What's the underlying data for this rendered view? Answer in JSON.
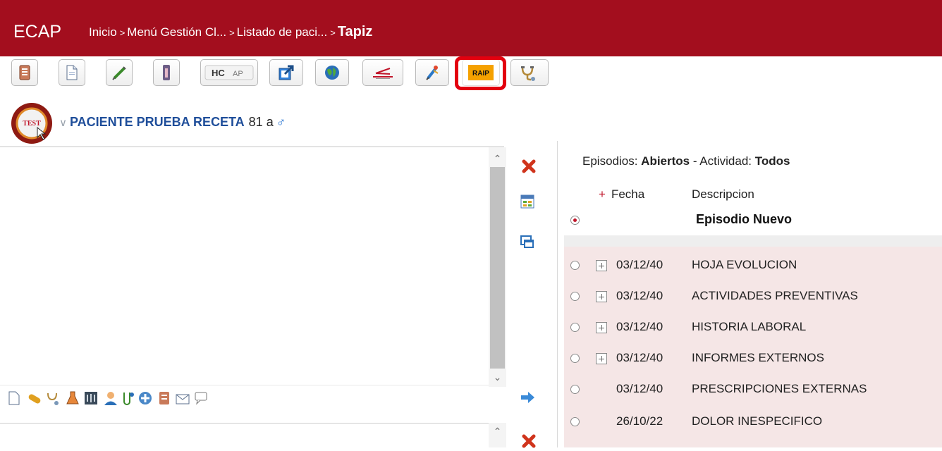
{
  "app": {
    "title": "ECAP"
  },
  "breadcrumb": {
    "items": [
      "Inicio",
      "Menú Gestión Cl...",
      "Listado de paci..."
    ],
    "current": "Tapiz",
    "separator": ">"
  },
  "toolbar": {
    "buttons": [
      {
        "name": "clinical-report-icon"
      },
      {
        "name": "document-icon"
      },
      {
        "name": "syringe-icon"
      },
      {
        "name": "thermometer-icon"
      },
      {
        "name": "hc-ap-button",
        "label": "HC AP"
      },
      {
        "name": "external-link-icon"
      },
      {
        "name": "globe-icon"
      },
      {
        "name": "chart-logo-icon"
      },
      {
        "name": "vaccine-icon"
      },
      {
        "name": "raip-button",
        "label": "RAIP"
      },
      {
        "name": "stethoscope-icon"
      }
    ],
    "highlighted": "raip-button",
    "highlight_color": "#e3000f"
  },
  "patient": {
    "avatar_text": "TEST",
    "name": "PACIENTE PRUEBA RECETA",
    "age": "81 a",
    "sex_symbol": "♂"
  },
  "episodes": {
    "filter_prefix": "Episodios: ",
    "filter_open": "Abiertos",
    "filter_middle": " - Actividad: ",
    "filter_activity": "Todos",
    "col_add": "+",
    "col_date": "Fecha",
    "col_desc": "Descripcion",
    "new_label": "Episodio Nuevo",
    "rows": [
      {
        "date": "03/12/40",
        "desc": "HOJA EVOLUCION",
        "expandable": true
      },
      {
        "date": "03/12/40",
        "desc": "ACTIVIDADES PREVENTIVAS",
        "expandable": true
      },
      {
        "date": "03/12/40",
        "desc": "HISTORIA LABORAL",
        "expandable": true
      },
      {
        "date": "03/12/40",
        "desc": "INFORMES EXTERNOS",
        "expandable": true
      },
      {
        "date": "03/12/40",
        "desc": "PRESCRIPCIONES EXTERNAS",
        "expandable": false
      },
      {
        "date": "26/10/22",
        "desc": "DOLOR INESPECIFICO",
        "expandable": false
      }
    ]
  },
  "colors": {
    "header": "#a30e1e",
    "patient_link": "#1f4e9a",
    "row_bg": "#f5e6e6",
    "accent": "#c0152a"
  }
}
